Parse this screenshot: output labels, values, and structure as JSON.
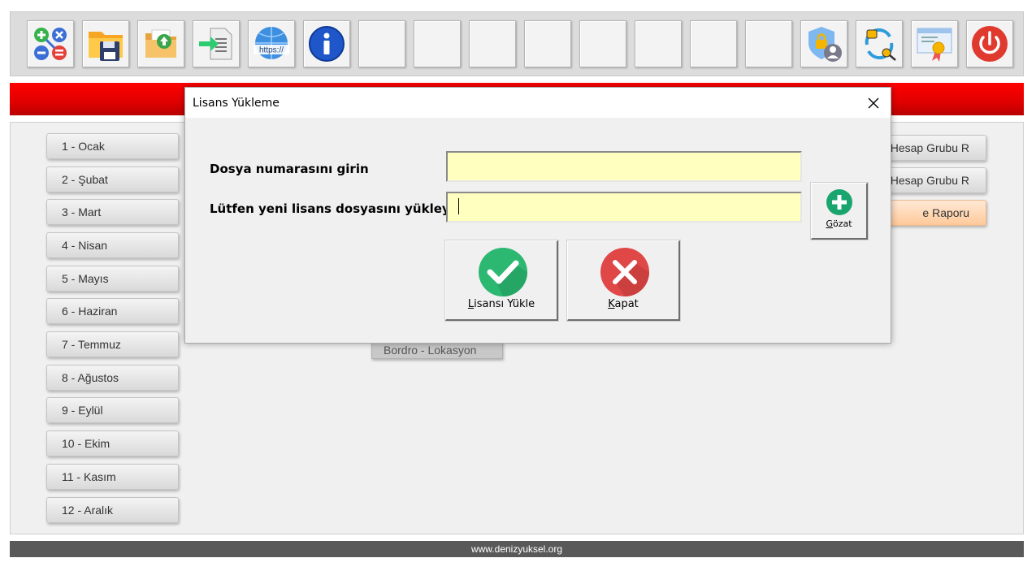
{
  "toolbar": {
    "buttons": [
      {
        "icon": "calculator-icon"
      },
      {
        "icon": "save-folder-icon"
      },
      {
        "icon": "upload-folder-icon"
      },
      {
        "icon": "import-document-icon"
      },
      {
        "icon": "web-globe-icon",
        "text": "https://"
      },
      {
        "icon": "info-icon"
      },
      {
        "icon": ""
      },
      {
        "icon": ""
      },
      {
        "icon": ""
      },
      {
        "icon": ""
      },
      {
        "icon": ""
      },
      {
        "icon": ""
      },
      {
        "icon": ""
      },
      {
        "icon": ""
      },
      {
        "icon": "user-security-icon"
      },
      {
        "icon": "license-sync-icon"
      },
      {
        "icon": "certificate-icon"
      },
      {
        "icon": "power-icon"
      }
    ]
  },
  "months": [
    "1 - Ocak",
    "2 - Şubat",
    "3 - Mart",
    "4 - Nisan",
    "5 - Mayıs",
    "6 - Haziran",
    "7 - Temmuz",
    "8 - Ağustos",
    "9 - Eylül",
    "10 - Ekim",
    "11 - Kasım",
    "12 - Aralık"
  ],
  "right_buttons": [
    "Hesap Grubu R",
    "e Hesap Grubu R",
    "e Raporu"
  ],
  "bordro_label": "Bordro - Lokasyon",
  "footer": "www.denizyuksel.org",
  "dialog": {
    "title": "Lisans Yükleme",
    "label_file_number": "Dosya numarasını girin",
    "label_license_file": "Lütfen yeni lisans dosyasını yükleyin",
    "file_number_value": "",
    "license_file_value": "",
    "browse": {
      "first": "G",
      "rest": "özat"
    },
    "load": {
      "first": "L",
      "rest": "isansı Yükle"
    },
    "close": {
      "first": "K",
      "rest": "apat"
    }
  },
  "colors": {
    "banner": "#e00000",
    "field": "#ffffc0",
    "load_icon": "#2db871",
    "close_icon": "#e04848",
    "browse_icon": "#1aa56f"
  }
}
